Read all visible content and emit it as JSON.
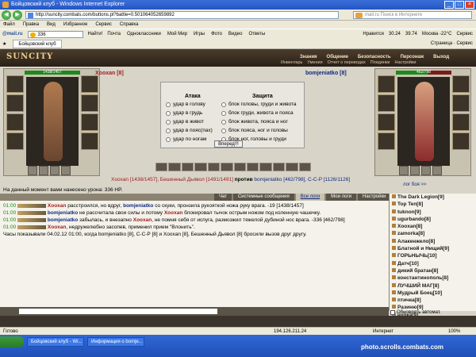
{
  "window": {
    "title": "Бойцовский клуб - Windows Internet Explorer",
    "address": "http://suncity.combats.com/buttons.pl?battle=0.501064052659892",
    "search_placeholder": "mail.ru Поиск в Интернете"
  },
  "menu": [
    "Файл",
    "Правка",
    "Вид",
    "Избранное",
    "Сервис",
    "Справка"
  ],
  "toolbar1": {
    "logo": "@mail.ru",
    "search_value": "336",
    "find": "Найти!",
    "items": [
      "Почта",
      "Одноклассники",
      "Мой Мир",
      "Игры",
      "Фото",
      "Видео",
      "Ответы"
    ],
    "right": [
      "Нравится",
      "30.24",
      "39.74",
      "Москва -22°C",
      "Сервис"
    ]
  },
  "toolbar2": {
    "tab": "Бойцовский клуб",
    "right": [
      "Страница",
      "Сервис"
    ]
  },
  "game": {
    "logo": "SUNCITY",
    "nav": [
      "Знания",
      "Общение",
      "Безопасность",
      "Персонаж",
      "Выход"
    ],
    "nav2": [
      "Инвентарь",
      "Умения",
      "Отчет о переводах",
      "Поединки",
      "Настройки"
    ]
  },
  "left_char": {
    "hp": "1438/1457",
    "name": "Xooxan [8]"
  },
  "right_char": {
    "hp": "462/798",
    "name": "bomjeniatko [8]"
  },
  "fight": {
    "attack_header": "Атака",
    "defense_header": "Защита",
    "attack": [
      "удар в голову",
      "удар в грудь",
      "удар в живот",
      "удар в пояс(пах)",
      "удар по ногам"
    ],
    "defense": [
      "блок головы, груди и живота",
      "блок груди, живота и пояса",
      "блок живота, пояса и ног",
      "блок пояса, ног и головы",
      "блок ног, головы и груди"
    ],
    "go": "Вперед!!!"
  },
  "vs": {
    "left": "Xooxan [1438/1457], Бешенный Дьявол [1491/1491]",
    "word": "против",
    "right": "bomjeniatko [462/798], C-C-P [1126/1126]"
  },
  "damage": "На данный момент вами нанесено урона: 336 HP.",
  "log_top": "лог боя >>",
  "chat_tabs": [
    "Чат",
    "Системные сообщения",
    "Все логи",
    "Мои логи",
    "Настройки"
  ],
  "chat": [
    {
      "time": "01:00",
      "a": "Xooxan",
      "text": " расстроился, но вдруг, ",
      "b": "bomjeniatko",
      "rest": " со скуки, пронзила рукояткой ножа руку врага. -19 [1438/1457]"
    },
    {
      "time": "01:00",
      "a": "bomjeniatko",
      "text": " не рассчитала свои силы и потому ",
      "b": "Xooxan",
      "rest": " блокировал тычок острым ножом под коленную чашечку."
    },
    {
      "time": "01:00",
      "a": "bomjeniatko",
      "text": " забылась, и внезапно ",
      "b": "Xooxan",
      "rest": ", не помня себя от испуга, размозжил тяжелой дубиной нос врага. -336 [462/798]"
    },
    {
      "time": "01:00",
      "a": "Xooxan",
      "text": ", недружелюбно засопев, применил прием \"Влонить\".",
      "b": "",
      "rest": ""
    },
    {
      "time": "",
      "a": "",
      "text": "Часы показывали 04.02.12 01:00, когда bomjeniatko [8], C-C-P [8] и Xooxan [8], Бешенный Дьявол [8] бросили вызов друг другу.",
      "b": "",
      "rest": ""
    }
  ],
  "online": [
    "The Dark Legion[9]",
    "Top Ten[8]",
    "tuknon[9]",
    "ugurbando[8]",
    "Xooxan[8]",
    "zamorka[8]",
    "Алакенжело[8]",
    "Блатной и Нищий[9]",
    "ГОРЬНЫЧЬ[10]",
    "Датч[10]",
    "дикий братан[8]",
    "константинополь[8]",
    "ЛУЧШИЙ МАГ[8]",
    "Мудрый Боец[10]",
    "птичка[8]",
    "Разиню[9]",
    "чупка[9]"
  ],
  "auto_label": "Обновлять автомат.",
  "status": {
    "left": "Готово",
    "ip": "194.126.211.24",
    "zone": "Интернет",
    "zoom": "100%"
  },
  "taskbar": [
    "Бойцовский клуб - Wi...",
    "Информация о bomje..."
  ],
  "watermark": "photo.scrolls.combats.com"
}
